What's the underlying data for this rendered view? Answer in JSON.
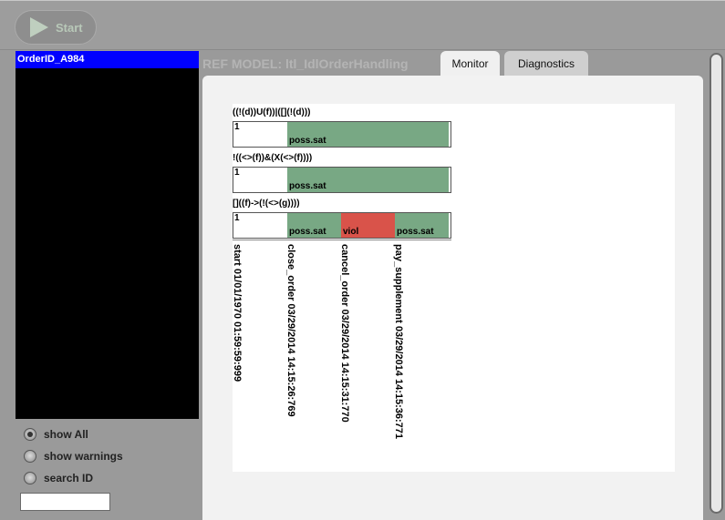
{
  "toolbar": {
    "start_label": "Start"
  },
  "sidebar": {
    "selected_order": "OrderID_A984",
    "filters": [
      {
        "label": "show All",
        "selected": true
      },
      {
        "label": "show warnings",
        "selected": false
      },
      {
        "label": "search ID",
        "selected": false
      }
    ],
    "search_value": ""
  },
  "header": {
    "ref_model": "REF MODEL: ltl_IdlOrderHandling"
  },
  "tabs": [
    {
      "label": "Monitor",
      "active": true
    },
    {
      "label": "Diagnostics",
      "active": false
    }
  ],
  "monitor": {
    "formulas": [
      {
        "expr": "((!(d))U(f))|([](!(d)))",
        "row_id": "1",
        "segments": [
          {
            "status": "poss.sat",
            "start": 1,
            "end": 4
          }
        ]
      },
      {
        "expr": "!((<>(f))&(X(<>(f))))",
        "row_id": "1",
        "segments": [
          {
            "status": "poss.sat",
            "start": 1,
            "end": 4
          }
        ]
      },
      {
        "expr": "[]((f)->(!(<>(g))))",
        "row_id": "1",
        "segments": [
          {
            "status": "poss.sat",
            "start": 1,
            "end": 2
          },
          {
            "status": "viol",
            "start": 2,
            "end": 3
          },
          {
            "status": "poss.sat",
            "start": 3,
            "end": 4
          }
        ]
      }
    ],
    "events": [
      "start 01/01/1970 01:59:59:999",
      "close_order 03/29/2014 14:15:26:769",
      "cancel_order 03/29/2014 14:15:31:770",
      "pay_supplement 03/29/2014 14:15:36:771"
    ],
    "colors": {
      "poss.sat": "#78a884",
      "viol": "#d9534a"
    }
  }
}
